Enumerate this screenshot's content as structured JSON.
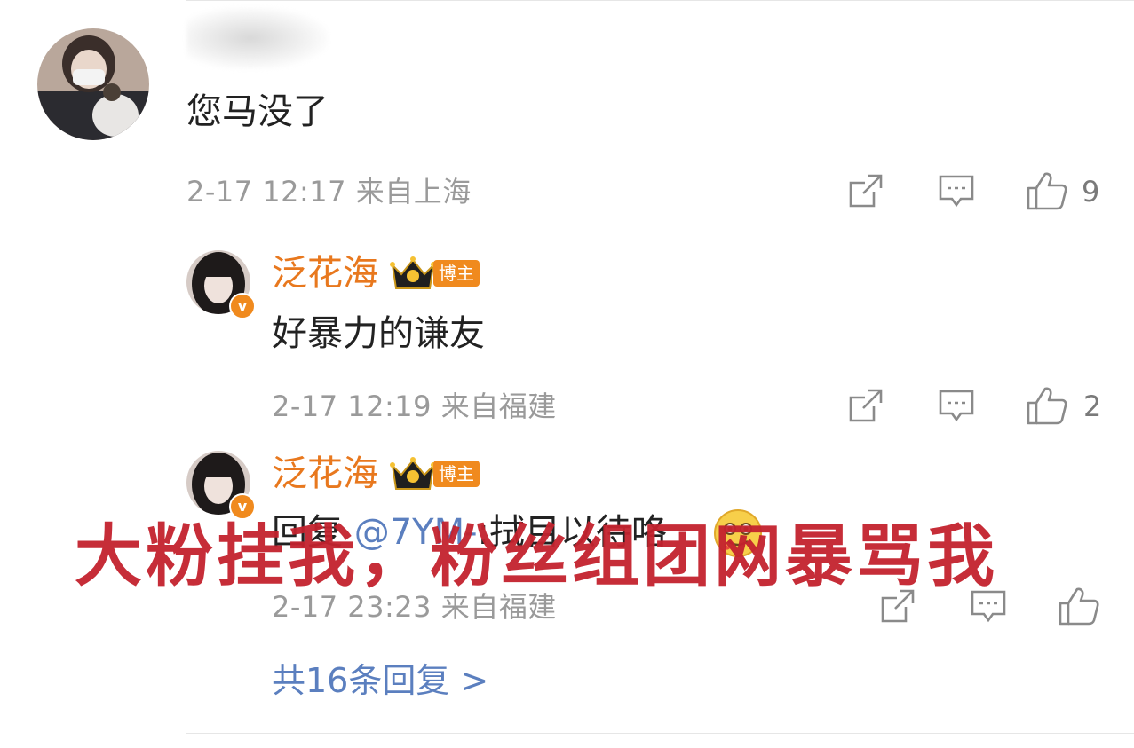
{
  "comments": {
    "main": {
      "text": "您马没了",
      "time": "2-17 12:17",
      "location": "来自上海",
      "like_count": "9"
    },
    "replies": [
      {
        "author": "泛花海",
        "badge": "博主",
        "text": "好暴力的谦友",
        "time": "2-17 12:19",
        "location": "来自福建",
        "like_count": "2"
      },
      {
        "author": "泛花海",
        "badge": "博主",
        "reply_prefix": "回复 ",
        "mention": "@7YM-",
        "text": ":拭目以待咯",
        "time": "2-17 23:23",
        "location": "来自福建"
      }
    ],
    "more_replies": "共16条回复 >"
  },
  "overlay": {
    "text": "大粉挂我，粉丝组团网暴骂我"
  },
  "colors": {
    "author": "#e8781e",
    "link": "#5b7fbf",
    "overlay": "#c4222e",
    "meta": "#9a9a9a"
  }
}
